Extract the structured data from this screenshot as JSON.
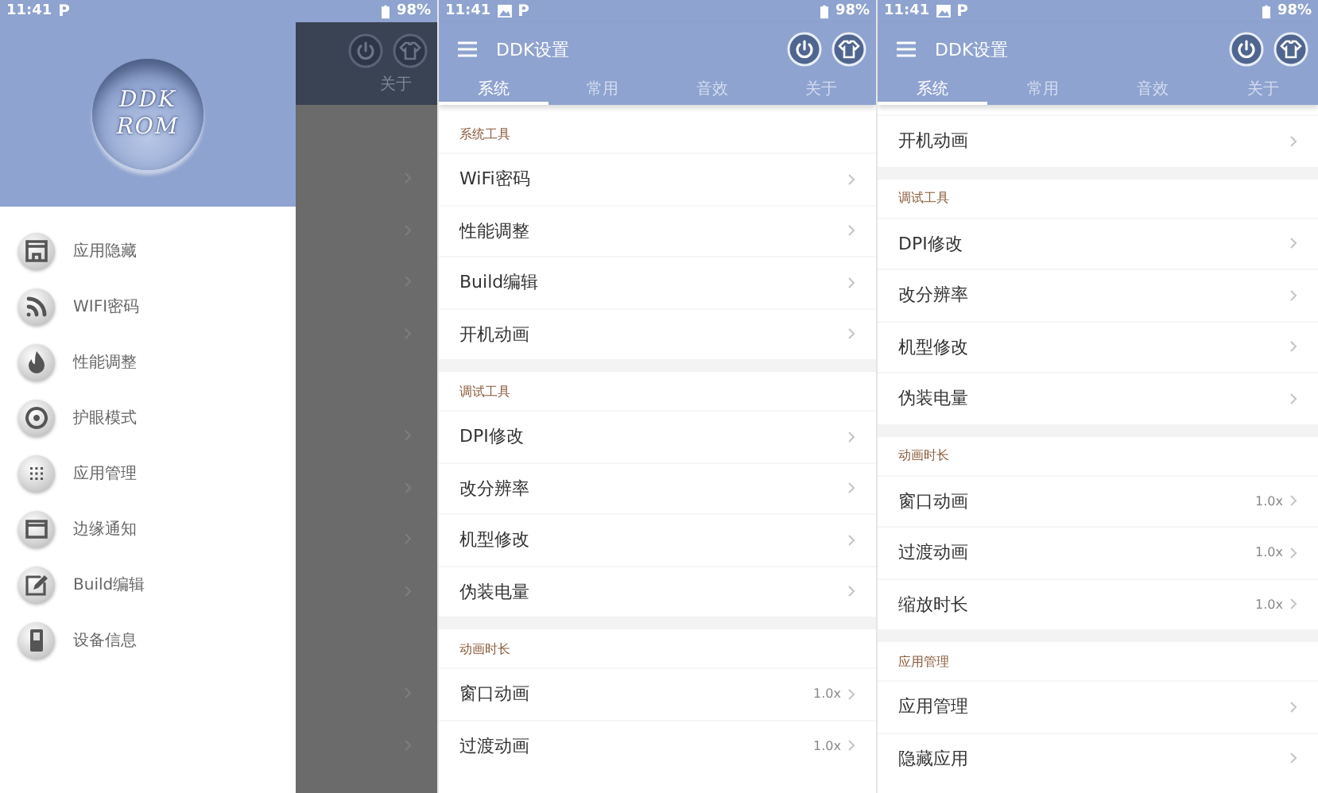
{
  "drawer_screen": {
    "status_bar": {
      "time": "11:41",
      "notification": "P",
      "image_notification": false,
      "battery": "98%"
    },
    "logo": {
      "lines": [
        "DDK",
        "ROM"
      ]
    },
    "menu": [
      {
        "label": "应用隐藏"
      },
      {
        "label": "WIFI密码"
      },
      {
        "label": "性能调整"
      },
      {
        "label": "护眼模式"
      },
      {
        "label": "应用管理"
      },
      {
        "label": "边缘通知"
      },
      {
        "label": "Build编辑"
      },
      {
        "label": "设备信息"
      }
    ],
    "background_tab": "关于"
  },
  "settings_screens": [
    {
      "status_bar": {
        "time": "11:41",
        "notification": "P",
        "image_notification": true,
        "battery": "98%"
      },
      "title": "DDK设置",
      "tabs": [
        {
          "label": "系统",
          "selected": true
        },
        {
          "label": "常用",
          "selected": false
        },
        {
          "label": "音效",
          "selected": false
        },
        {
          "label": "关于",
          "selected": false
        }
      ],
      "sections": [
        {
          "title": "系统工具",
          "items": [
            {
              "label": "WiFi密码"
            },
            {
              "label": "性能调整"
            },
            {
              "label": "Build编辑"
            },
            {
              "label": "开机动画"
            }
          ]
        },
        {
          "title": "调试工具",
          "items": [
            {
              "label": "DPI修改"
            },
            {
              "label": "改分辨率"
            },
            {
              "label": "机型修改"
            },
            {
              "label": "伪装电量"
            }
          ]
        },
        {
          "title": "动画时长",
          "items": [
            {
              "label": "窗口动画",
              "value": "1.0x"
            },
            {
              "label": "过渡动画",
              "value": "1.0x"
            }
          ]
        }
      ]
    },
    {
      "status_bar": {
        "time": "11:41",
        "notification": "P",
        "image_notification": true,
        "battery": "98%"
      },
      "title": "DDK设置",
      "tabs": [
        {
          "label": "系统",
          "selected": true
        },
        {
          "label": "常用",
          "selected": false
        },
        {
          "label": "音效",
          "selected": false
        },
        {
          "label": "关于",
          "selected": false
        }
      ],
      "sections": [
        {
          "items": [
            {
              "label": "开机动画"
            }
          ]
        },
        {
          "title": "调试工具",
          "items": [
            {
              "label": "DPI修改"
            },
            {
              "label": "改分辨率"
            },
            {
              "label": "机型修改"
            },
            {
              "label": "伪装电量"
            }
          ]
        },
        {
          "title": "动画时长",
          "items": [
            {
              "label": "窗口动画",
              "value": "1.0x"
            },
            {
              "label": "过渡动画",
              "value": "1.0x"
            },
            {
              "label": "缩放时长",
              "value": "1.0x"
            }
          ]
        },
        {
          "title": "应用管理",
          "items": [
            {
              "label": "应用管理"
            },
            {
              "label": "隐藏应用"
            }
          ]
        }
      ]
    }
  ]
}
